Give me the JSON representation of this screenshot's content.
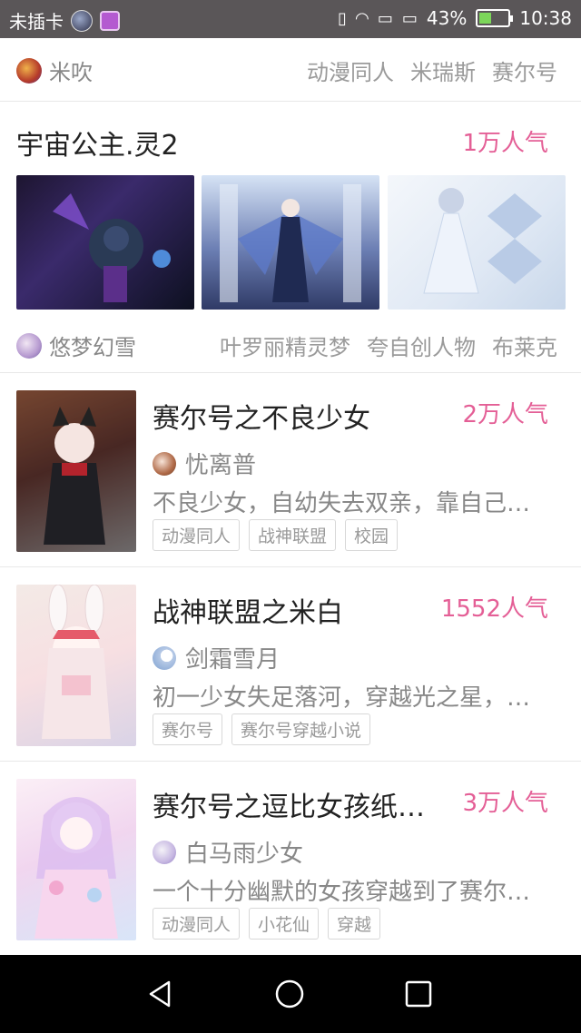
{
  "status_bar": {
    "carrier": "未插卡",
    "battery": "43%",
    "time": "10:38",
    "battery_level": 0.43
  },
  "top_row": {
    "author": "米吹",
    "tags": [
      "动漫同人",
      "米瑞斯",
      "赛尔号"
    ]
  },
  "featured": {
    "title": "宇宙公主.灵2",
    "popularity": "1万人气",
    "author": "悠梦幻雪",
    "tags": [
      "叶罗丽精灵梦",
      "夸自创人物",
      "布莱克"
    ]
  },
  "books": [
    {
      "title": "赛尔号之不良少女",
      "popularity": "2万人气",
      "author": "忧离普",
      "description": "不良少女，自幼失去双亲，靠自己…",
      "tags": [
        "动漫同人",
        "战神联盟",
        "校园"
      ]
    },
    {
      "title": "战神联盟之米白",
      "popularity": "1552人气",
      "author": "剑霜雪月",
      "description": "初一少女失足落河，穿越光之星，…",
      "tags": [
        "赛尔号",
        "赛尔号穿越小说"
      ]
    },
    {
      "title": "赛尔号之逗比女孩纸…",
      "popularity": "3万人气",
      "author": "白马雨少女",
      "description": "一个十分幽默的女孩穿越到了赛尔…",
      "tags": [
        "动漫同人",
        "小花仙",
        "穿越"
      ]
    }
  ],
  "colors": {
    "accent_popularity": "#e45f96",
    "status_bar_bg": "#5a5658",
    "nav_bar_bg": "#000000"
  }
}
